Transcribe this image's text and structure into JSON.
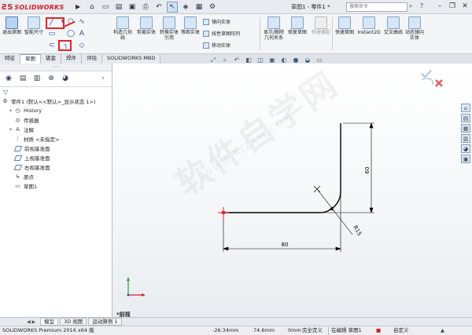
{
  "app": {
    "logo": "SOLIDWORKS",
    "document_title": "草图1 - 零件1 *",
    "search_placeholder": "搜索命令"
  },
  "ribbon": {
    "exit_sketch": "退出草图",
    "smart_dimension": "智能尺寸",
    "construct_geometry": "构造几何线",
    "trim_entities": "剪裁实体",
    "convert_entities": "转换实体引用",
    "offset_entities": "等距实体",
    "mirror_entities": "镜向实体",
    "linear_pattern": "线性草图阵列",
    "move_entities": "移动实体",
    "display_relations": "显示/删除几何关系",
    "repair_sketch": "修复草图",
    "quick_snaps": "快速捕捉",
    "rapid_sketch": "快速草图",
    "instant2d": "Instant2D",
    "intersection_curve": "交叉曲线",
    "dynamic_mirror": "动态镜向实体"
  },
  "tabs": [
    "特征",
    "草图",
    "钣金",
    "焊件",
    "评估",
    "SOLIDWORKS MBD"
  ],
  "active_tab": "草图",
  "feature_tree": {
    "root": "零件1 (默认<<默认>_显示状态 1>)",
    "items": [
      "History",
      "传感器",
      "注解",
      "材质 <未指定>",
      "前视基准面",
      "上视基准面",
      "右视基准面",
      "原点",
      "草图1"
    ]
  },
  "drawing": {
    "dim_horizontal": "80",
    "dim_vertical": "60",
    "dim_radius": "R15",
    "view_label": "*前视",
    "colors": {
      "sketch_line": "#000000",
      "origin": "#e0262d",
      "axis_y": "#2ca02c",
      "axis_x": "#d21f26"
    }
  },
  "watermark": {
    "main": "软件自学网",
    "url": "WWW.RJZXW.COM"
  },
  "bottom_tabs": [
    "模型",
    "3D 视图",
    "运动算例 1"
  ],
  "status": {
    "product": "SOLIDWORKS Premium 2016 x64 版",
    "x": "-26.34mm",
    "y": "74.6mm",
    "z": "0mm",
    "state": "完全定义",
    "editing": "在编辑 草图1",
    "units": "自定义"
  }
}
